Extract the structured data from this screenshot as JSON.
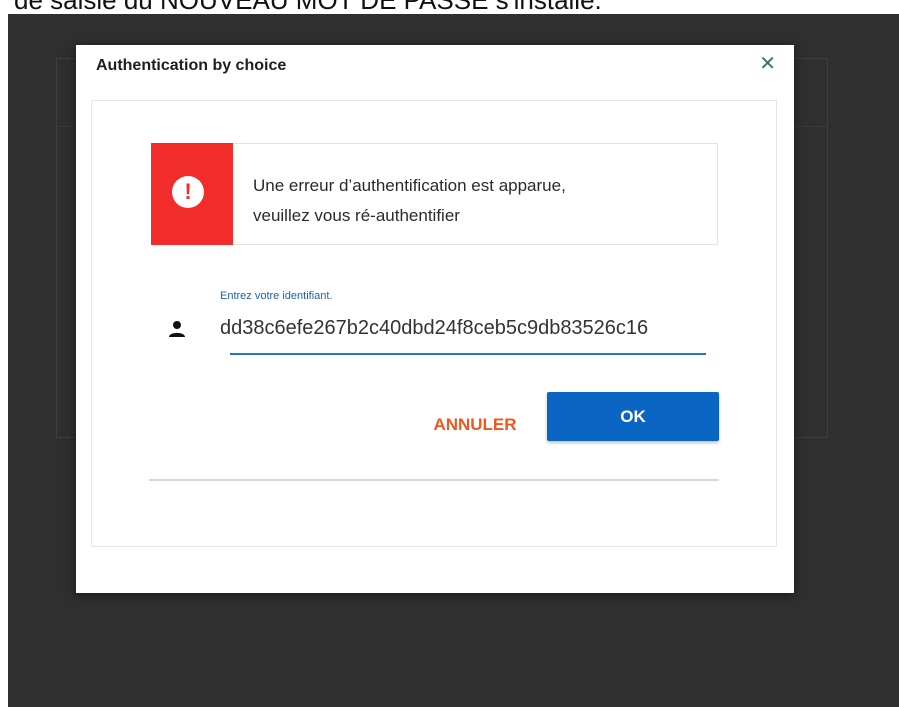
{
  "page": {
    "caption": "de saisie du NOUVEAU MOT DE PASSE s'installe."
  },
  "dialog": {
    "title": "Authentication by choice",
    "close_icon": "close-icon",
    "close_symbol": "✕"
  },
  "error": {
    "icon": "exclamation-icon",
    "symbol": "!",
    "line1": "Une erreur d’authentification est apparue,",
    "line2": "veuillez vous ré-authentifier",
    "color": "#f22b2b"
  },
  "identifier": {
    "label": "Entrez votre identifiant.",
    "icon": "user-icon",
    "value": "dd38c6efe267b2c40dbd24f8ceb5c9db83526c16"
  },
  "actions": {
    "cancel_label": "ANNULER",
    "ok_label": "OK",
    "cancel_color": "#f0561e",
    "ok_color": "#0a66c2"
  }
}
